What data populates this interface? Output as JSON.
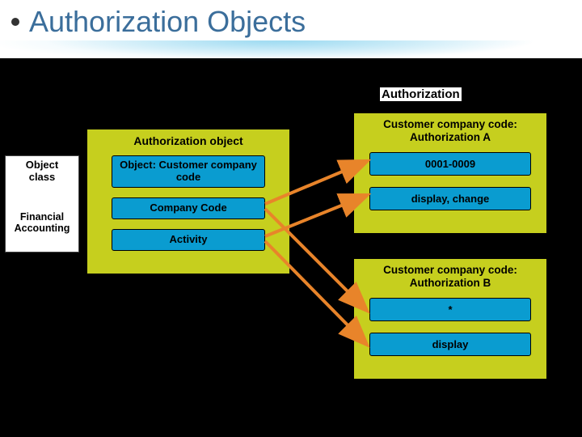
{
  "slide": {
    "title": "Authorization Objects",
    "section_label": "Authorization"
  },
  "object_class": {
    "header1": "Object",
    "header2": "class",
    "value1": "Financial",
    "value2": "Accounting"
  },
  "auth_object": {
    "title": "Authorization object",
    "object_label": "Object: Customer company code",
    "field1": "Company Code",
    "field2": "Activity"
  },
  "auth_a": {
    "title": "Customer company code: Authorization A",
    "value1": "0001-0009",
    "value2": "display, change"
  },
  "auth_b": {
    "title": "Customer company code: Authorization B",
    "value1": "*",
    "value2": "display"
  }
}
